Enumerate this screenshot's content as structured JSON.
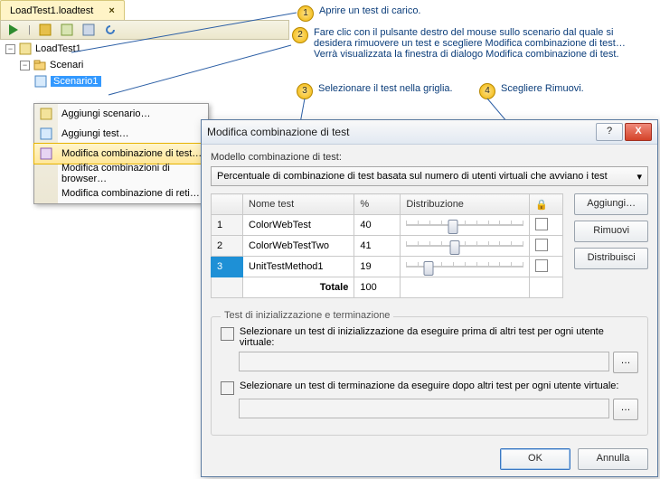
{
  "tab": {
    "title": "LoadTest1.loadtest",
    "close": "×"
  },
  "tree": {
    "root": "LoadTest1",
    "scenariFolder": "Scenari",
    "scenario1": "Scenario1",
    "expanderMinus": "−"
  },
  "contextMenu": {
    "addScenario": "Aggiungi scenario…",
    "addTest": "Aggiungi test…",
    "editTestMix": "Modifica combinazione di test…",
    "editBrowserMix": "Modifica combinazioni di browser…",
    "editNetworkMix": "Modifica combinazione di reti…"
  },
  "callouts": {
    "c1": "Aprire un test di carico.",
    "c2": "Fare clic con il pulsante destro del mouse sullo scenario dal quale si desidera rimuovere un test e scegliere Modifica combinazione di test… Verrà visualizzata la finestra di dialogo Modifica combinazione di test.",
    "c3": "Selezionare il test nella griglia.",
    "c4": "Scegliere Rimuovi."
  },
  "dialog": {
    "title": "Modifica combinazione di test",
    "help": "?",
    "closeX": "X",
    "modelLabel": "Modello combinazione di test:",
    "modelValue": "Percentuale di combinazione di test basata sul numero di utenti virtuali che avviano i test",
    "dropdownArrow": "▾",
    "headers": {
      "name": "Nome test",
      "pct": "%",
      "dist": "Distribuzione",
      "lock": "🔒"
    },
    "rows": [
      {
        "n": "1",
        "name": "ColorWebTest",
        "pct": "40",
        "sliderPos": 40
      },
      {
        "n": "2",
        "name": "ColorWebTestTwo",
        "pct": "41",
        "sliderPos": 41
      },
      {
        "n": "3",
        "name": "UnitTestMethod1",
        "pct": "19",
        "sliderPos": 19
      }
    ],
    "totalLabel": "Totale",
    "totalValue": "100",
    "buttons": {
      "add": "Aggiungi…",
      "remove": "Rimuovi",
      "distribute": "Distribuisci"
    },
    "fieldset": {
      "legend": "Test di inizializzazione e terminazione",
      "initLabel": "Selezionare un test di inizializzazione da eseguire prima di altri test per ogni utente virtuale:",
      "termLabel": "Selezionare un test di terminazione da eseguire dopo altri test per ogni utente virtuale:",
      "browse": "…"
    },
    "ok": "OK",
    "cancel": "Annulla"
  }
}
